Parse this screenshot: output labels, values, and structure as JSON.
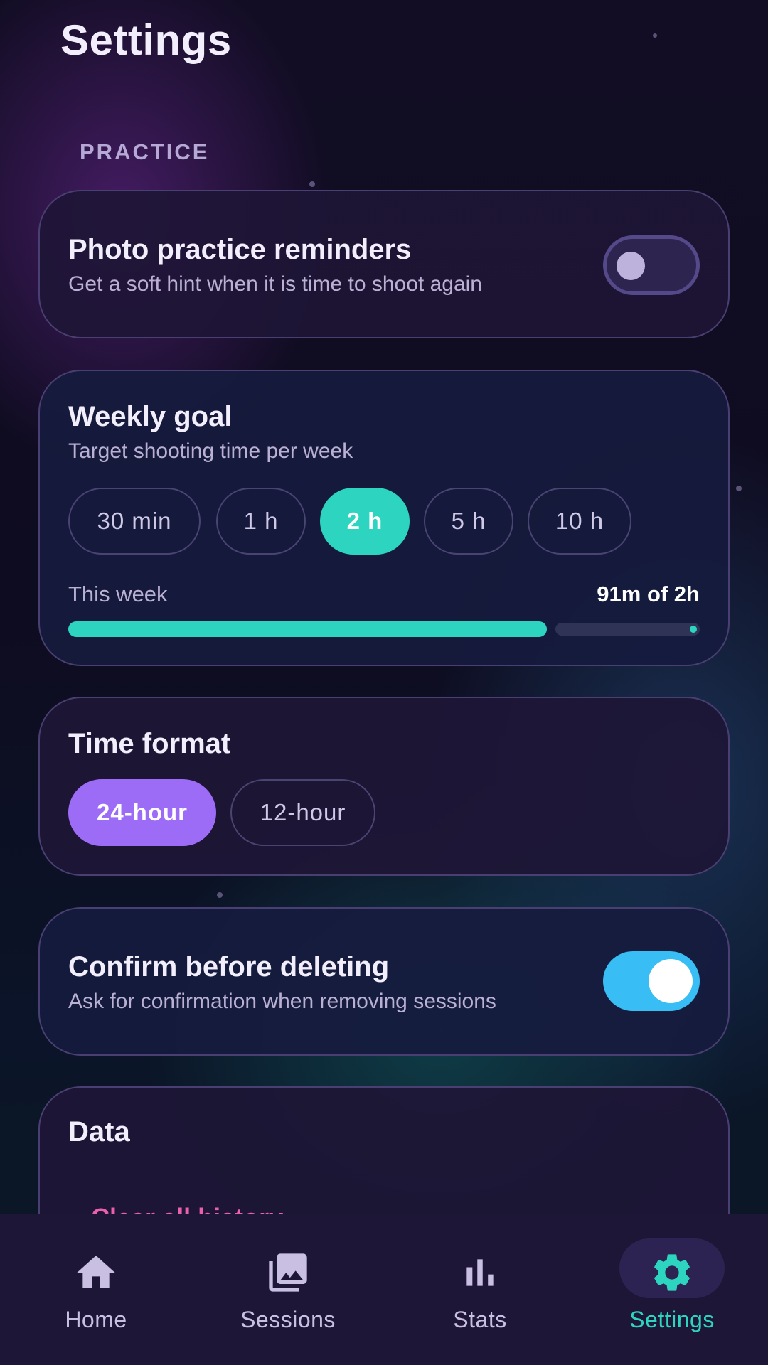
{
  "header": {
    "title": "Settings"
  },
  "section": {
    "label": "PRACTICE"
  },
  "reminders": {
    "title": "Photo practice reminders",
    "subtitle": "Get a soft hint when it is time to shoot again",
    "enabled": false
  },
  "weekly_goal": {
    "title": "Weekly goal",
    "subtitle": "Target shooting time per week",
    "options": [
      "30 min",
      "1 h",
      "2 h",
      "5 h",
      "10 h"
    ],
    "selected": "2 h",
    "progress_label": "This week",
    "progress_value": "91m of 2h",
    "progress_fraction": 0.758
  },
  "time_format": {
    "title": "Time format",
    "options": [
      "24-hour",
      "12-hour"
    ],
    "selected": "24-hour"
  },
  "confirm_delete": {
    "title": "Confirm before deleting",
    "subtitle": "Ask for confirmation when removing sessions",
    "enabled": true
  },
  "data_section": {
    "title": "Data",
    "clear_label": "Clear all history"
  },
  "nav": {
    "items": [
      {
        "label": "Home",
        "icon": "home-icon"
      },
      {
        "label": "Sessions",
        "icon": "photo-library-icon"
      },
      {
        "label": "Stats",
        "icon": "bar-chart-icon"
      },
      {
        "label": "Settings",
        "icon": "gear-icon"
      }
    ],
    "active": "Settings"
  },
  "colors": {
    "accent_teal": "#2dd4bf",
    "accent_purple": "#9d6cf7",
    "toggle_on": "#38bdf4",
    "danger": "#ec5fae"
  }
}
